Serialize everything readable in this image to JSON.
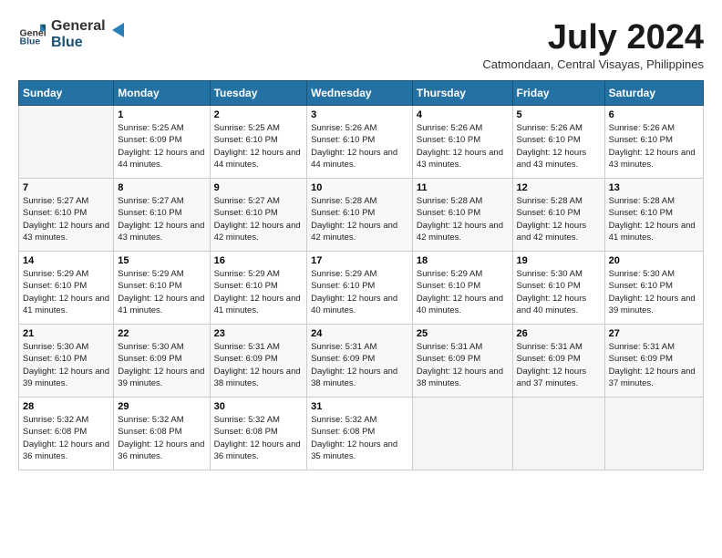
{
  "header": {
    "logo_general": "General",
    "logo_blue": "Blue",
    "month_year": "July 2024",
    "location": "Catmondaan, Central Visayas, Philippines"
  },
  "days_header": [
    "Sunday",
    "Monday",
    "Tuesday",
    "Wednesday",
    "Thursday",
    "Friday",
    "Saturday"
  ],
  "weeks": [
    [
      {
        "day": "",
        "sunrise": "",
        "sunset": "",
        "daylight": ""
      },
      {
        "day": "1",
        "sunrise": "Sunrise: 5:25 AM",
        "sunset": "Sunset: 6:09 PM",
        "daylight": "Daylight: 12 hours and 44 minutes."
      },
      {
        "day": "2",
        "sunrise": "Sunrise: 5:25 AM",
        "sunset": "Sunset: 6:10 PM",
        "daylight": "Daylight: 12 hours and 44 minutes."
      },
      {
        "day": "3",
        "sunrise": "Sunrise: 5:26 AM",
        "sunset": "Sunset: 6:10 PM",
        "daylight": "Daylight: 12 hours and 44 minutes."
      },
      {
        "day": "4",
        "sunrise": "Sunrise: 5:26 AM",
        "sunset": "Sunset: 6:10 PM",
        "daylight": "Daylight: 12 hours and 43 minutes."
      },
      {
        "day": "5",
        "sunrise": "Sunrise: 5:26 AM",
        "sunset": "Sunset: 6:10 PM",
        "daylight": "Daylight: 12 hours and 43 minutes."
      },
      {
        "day": "6",
        "sunrise": "Sunrise: 5:26 AM",
        "sunset": "Sunset: 6:10 PM",
        "daylight": "Daylight: 12 hours and 43 minutes."
      }
    ],
    [
      {
        "day": "7",
        "sunrise": "Sunrise: 5:27 AM",
        "sunset": "Sunset: 6:10 PM",
        "daylight": "Daylight: 12 hours and 43 minutes."
      },
      {
        "day": "8",
        "sunrise": "Sunrise: 5:27 AM",
        "sunset": "Sunset: 6:10 PM",
        "daylight": "Daylight: 12 hours and 43 minutes."
      },
      {
        "day": "9",
        "sunrise": "Sunrise: 5:27 AM",
        "sunset": "Sunset: 6:10 PM",
        "daylight": "Daylight: 12 hours and 42 minutes."
      },
      {
        "day": "10",
        "sunrise": "Sunrise: 5:28 AM",
        "sunset": "Sunset: 6:10 PM",
        "daylight": "Daylight: 12 hours and 42 minutes."
      },
      {
        "day": "11",
        "sunrise": "Sunrise: 5:28 AM",
        "sunset": "Sunset: 6:10 PM",
        "daylight": "Daylight: 12 hours and 42 minutes."
      },
      {
        "day": "12",
        "sunrise": "Sunrise: 5:28 AM",
        "sunset": "Sunset: 6:10 PM",
        "daylight": "Daylight: 12 hours and 42 minutes."
      },
      {
        "day": "13",
        "sunrise": "Sunrise: 5:28 AM",
        "sunset": "Sunset: 6:10 PM",
        "daylight": "Daylight: 12 hours and 41 minutes."
      }
    ],
    [
      {
        "day": "14",
        "sunrise": "Sunrise: 5:29 AM",
        "sunset": "Sunset: 6:10 PM",
        "daylight": "Daylight: 12 hours and 41 minutes."
      },
      {
        "day": "15",
        "sunrise": "Sunrise: 5:29 AM",
        "sunset": "Sunset: 6:10 PM",
        "daylight": "Daylight: 12 hours and 41 minutes."
      },
      {
        "day": "16",
        "sunrise": "Sunrise: 5:29 AM",
        "sunset": "Sunset: 6:10 PM",
        "daylight": "Daylight: 12 hours and 41 minutes."
      },
      {
        "day": "17",
        "sunrise": "Sunrise: 5:29 AM",
        "sunset": "Sunset: 6:10 PM",
        "daylight": "Daylight: 12 hours and 40 minutes."
      },
      {
        "day": "18",
        "sunrise": "Sunrise: 5:29 AM",
        "sunset": "Sunset: 6:10 PM",
        "daylight": "Daylight: 12 hours and 40 minutes."
      },
      {
        "day": "19",
        "sunrise": "Sunrise: 5:30 AM",
        "sunset": "Sunset: 6:10 PM",
        "daylight": "Daylight: 12 hours and 40 minutes."
      },
      {
        "day": "20",
        "sunrise": "Sunrise: 5:30 AM",
        "sunset": "Sunset: 6:10 PM",
        "daylight": "Daylight: 12 hours and 39 minutes."
      }
    ],
    [
      {
        "day": "21",
        "sunrise": "Sunrise: 5:30 AM",
        "sunset": "Sunset: 6:10 PM",
        "daylight": "Daylight: 12 hours and 39 minutes."
      },
      {
        "day": "22",
        "sunrise": "Sunrise: 5:30 AM",
        "sunset": "Sunset: 6:09 PM",
        "daylight": "Daylight: 12 hours and 39 minutes."
      },
      {
        "day": "23",
        "sunrise": "Sunrise: 5:31 AM",
        "sunset": "Sunset: 6:09 PM",
        "daylight": "Daylight: 12 hours and 38 minutes."
      },
      {
        "day": "24",
        "sunrise": "Sunrise: 5:31 AM",
        "sunset": "Sunset: 6:09 PM",
        "daylight": "Daylight: 12 hours and 38 minutes."
      },
      {
        "day": "25",
        "sunrise": "Sunrise: 5:31 AM",
        "sunset": "Sunset: 6:09 PM",
        "daylight": "Daylight: 12 hours and 38 minutes."
      },
      {
        "day": "26",
        "sunrise": "Sunrise: 5:31 AM",
        "sunset": "Sunset: 6:09 PM",
        "daylight": "Daylight: 12 hours and 37 minutes."
      },
      {
        "day": "27",
        "sunrise": "Sunrise: 5:31 AM",
        "sunset": "Sunset: 6:09 PM",
        "daylight": "Daylight: 12 hours and 37 minutes."
      }
    ],
    [
      {
        "day": "28",
        "sunrise": "Sunrise: 5:32 AM",
        "sunset": "Sunset: 6:08 PM",
        "daylight": "Daylight: 12 hours and 36 minutes."
      },
      {
        "day": "29",
        "sunrise": "Sunrise: 5:32 AM",
        "sunset": "Sunset: 6:08 PM",
        "daylight": "Daylight: 12 hours and 36 minutes."
      },
      {
        "day": "30",
        "sunrise": "Sunrise: 5:32 AM",
        "sunset": "Sunset: 6:08 PM",
        "daylight": "Daylight: 12 hours and 36 minutes."
      },
      {
        "day": "31",
        "sunrise": "Sunrise: 5:32 AM",
        "sunset": "Sunset: 6:08 PM",
        "daylight": "Daylight: 12 hours and 35 minutes."
      },
      {
        "day": "",
        "sunrise": "",
        "sunset": "",
        "daylight": ""
      },
      {
        "day": "",
        "sunrise": "",
        "sunset": "",
        "daylight": ""
      },
      {
        "day": "",
        "sunrise": "",
        "sunset": "",
        "daylight": ""
      }
    ]
  ]
}
